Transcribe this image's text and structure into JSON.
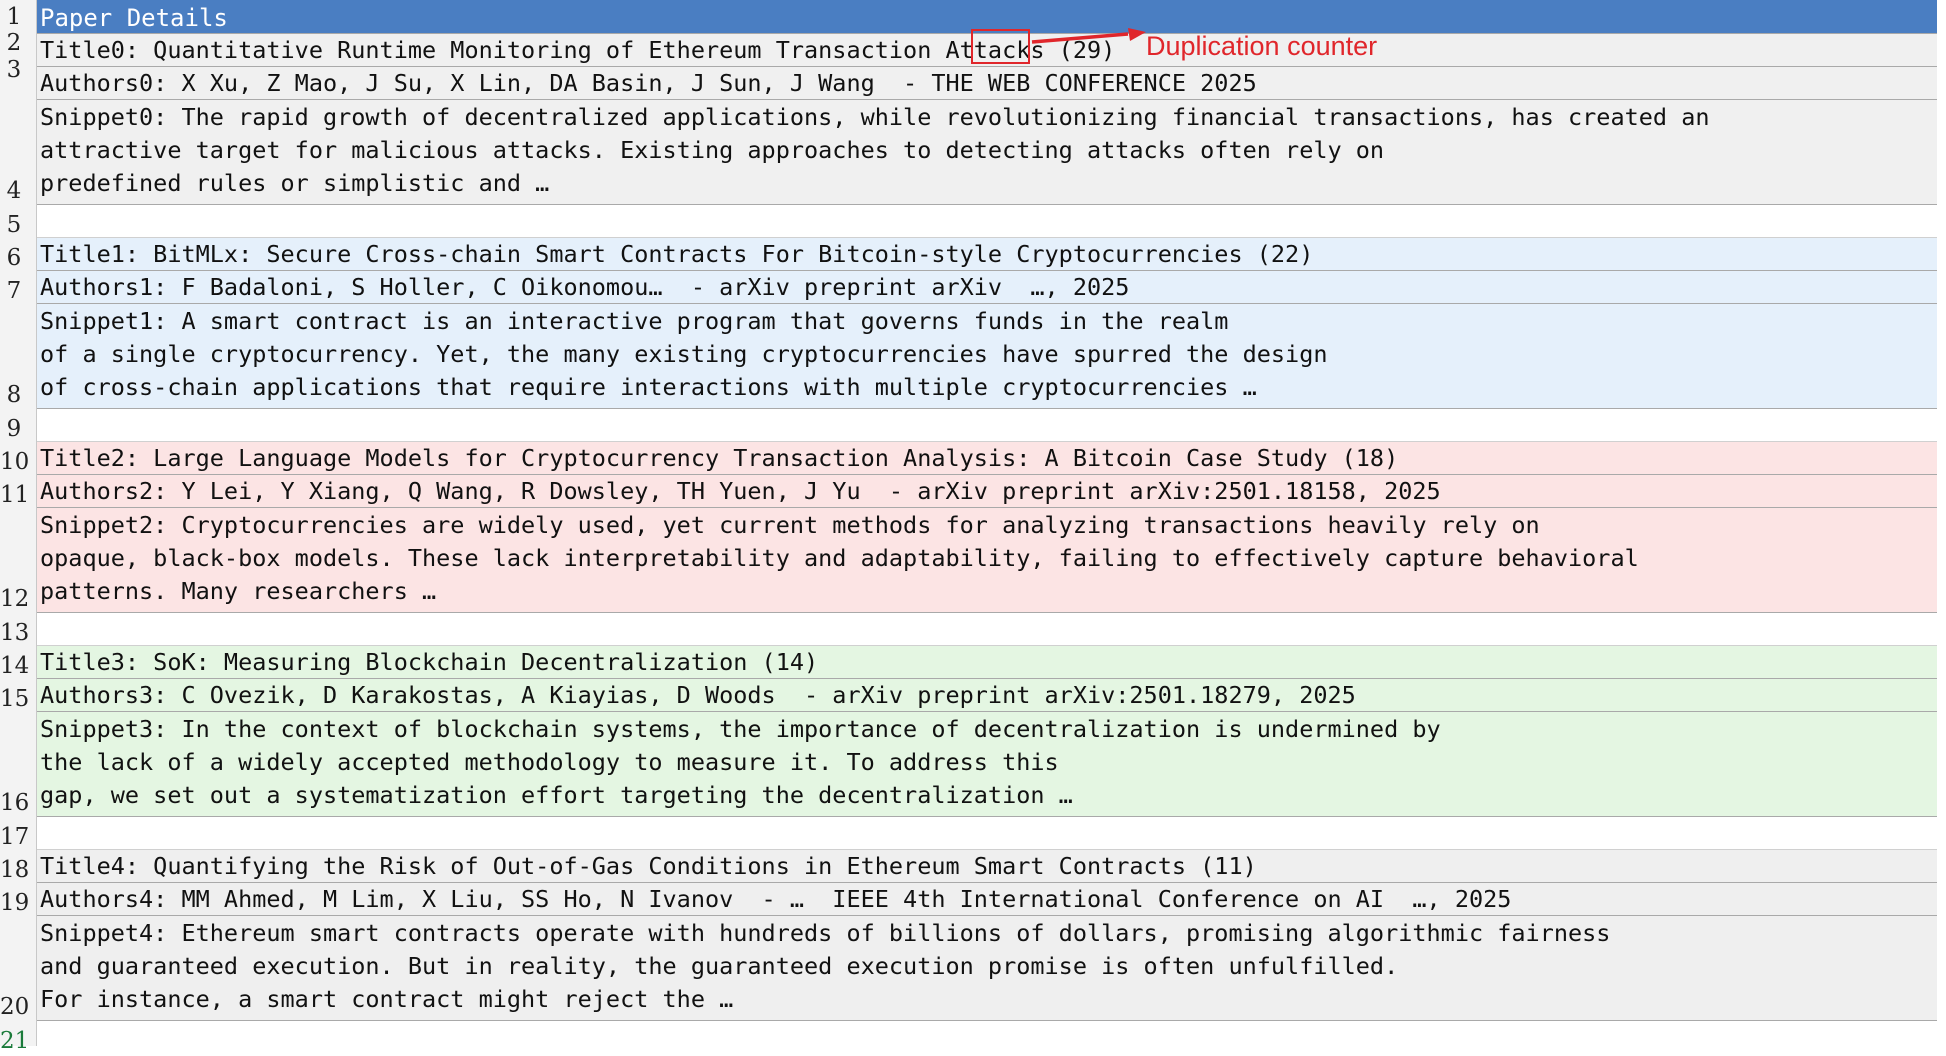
{
  "sheet": {
    "header": "Paper Details",
    "row_numbers": [
      "1",
      "2",
      "3",
      "4",
      "5",
      "6",
      "7",
      "8",
      "9",
      "10",
      "11",
      "12",
      "13",
      "14",
      "15",
      "16",
      "17",
      "18",
      "19",
      "20",
      "21"
    ],
    "papers": [
      {
        "title": "Title0: Quantitative Runtime Monitoring of Ethereum Transaction Attacks (29)",
        "authors": "Authors0: X Xu, Z Mao, J Su, X Lin, DA Basin, J Sun, J Wang  - THE WEB CONFERENCE 2025",
        "snippet": [
          "Snippet0: The rapid growth of decentralized applications, while revolutionizing financial transactions, has created an",
          "attractive target for malicious attacks. Existing approaches to detecting attacks often rely on",
          "predefined rules or simplistic and …"
        ]
      },
      {
        "title": "Title1: BitMLx: Secure Cross-chain Smart Contracts For Bitcoin-style Cryptocurrencies (22)",
        "authors": "Authors1: F Badaloni, S Holler, C Oikonomou…  - arXiv preprint arXiv  …, 2025",
        "snippet": [
          "Snippet1: A smart contract is an interactive program that governs funds in the realm",
          "of a single cryptocurrency. Yet, the many existing cryptocurrencies have spurred the design",
          "of cross-chain applications that require interactions with multiple cryptocurrencies …"
        ]
      },
      {
        "title": "Title2: Large Language Models for Cryptocurrency Transaction Analysis: A Bitcoin Case Study (18)",
        "authors": "Authors2: Y Lei, Y Xiang, Q Wang, R Dowsley, TH Yuen, J Yu  - arXiv preprint arXiv:2501.18158, 2025",
        "snippet": [
          "Snippet2: Cryptocurrencies are widely used, yet current methods for analyzing transactions heavily rely on",
          "opaque, black-box models. These lack interpretability and adaptability, failing to effectively capture behavioral",
          "patterns. Many researchers …"
        ]
      },
      {
        "title": "Title3: SoK: Measuring Blockchain Decentralization (14)",
        "authors": "Authors3: C Ovezik, D Karakostas, A Kiayias, D Woods  - arXiv preprint arXiv:2501.18279, 2025",
        "snippet": [
          "Snippet3: In the context of blockchain systems, the importance of decentralization is undermined by",
          "the lack of a widely accepted methodology to measure it. To address this",
          "gap, we set out a systematization effort targeting the decentralization …"
        ]
      },
      {
        "title": "Title4: Quantifying the Risk of Out-of-Gas Conditions in Ethereum Smart Contracts (11)",
        "authors": "Authors4: MM Ahmed, M Lim, X Liu, SS Ho, N Ivanov  - …  IEEE 4th International Conference on AI  …, 2025",
        "snippet": [
          "Snippet4: Ethereum smart contracts operate with hundreds of billions of dollars, promising algorithmic fairness",
          "and guaranteed execution. But in reality, the guaranteed execution promise is often unfulfilled.",
          "For instance, a smart contract might reject the …"
        ]
      }
    ]
  },
  "annotation": {
    "label": "Duplication counter",
    "color": "#e0262b"
  },
  "colors": {
    "header": "#4a7ec2",
    "group0": "#f0f0f0",
    "group1": "#e5f0fb",
    "group2": "#fce4e4",
    "group3": "#e4f6e2",
    "group4": "#efefef"
  }
}
